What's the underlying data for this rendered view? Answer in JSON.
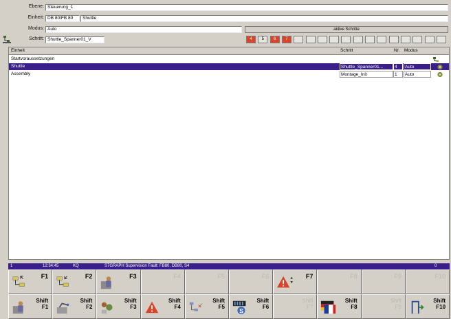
{
  "header": {
    "ebene_label": "Ebene:",
    "ebene_value": "Steuerung_1",
    "einheit_label": "Einheit:",
    "einheit_code": "DB 80/FB 80",
    "einheit_value": "Shuttle",
    "modus_label": "Modus:",
    "modus_value": "Auto",
    "schritt_label": "Schritt:",
    "schritt_value": "Shuttle_Spanner01_V",
    "active_steps_label": "aktive Schritte",
    "step_cells": [
      "4",
      "5",
      "6",
      "7",
      "",
      "",
      "",
      "",
      "",
      "",
      "",
      "",
      "",
      "",
      "",
      "",
      ""
    ]
  },
  "table": {
    "columns": {
      "einheit": "Einheit",
      "schritt": "Schritt",
      "nr": "Nr.",
      "modus": "Modus"
    },
    "rows": [
      {
        "einheit": "Startvoraussetzungen",
        "schritt": "",
        "nr": "",
        "modus": "",
        "icon": "hierarchy-icon"
      },
      {
        "einheit": "Shuttle",
        "schritt": "Shuttle_Spanner01...",
        "nr": "4",
        "modus": "Auto",
        "icon": "gear-icon"
      },
      {
        "einheit": "Assembly",
        "schritt": "Montage_Init",
        "nr": "1",
        "modus": "Auto",
        "icon": "gear-icon"
      }
    ]
  },
  "status_bar": {
    "index": "1",
    "time": "12:34:45",
    "ack": "KQ",
    "message": "S7GRAPH Supervision Fault: FB80, DB80, S4",
    "count": "0"
  },
  "fkeys_row1": [
    {
      "label": "F1",
      "icon": "unit-up-icon",
      "enabled": true
    },
    {
      "label": "F2",
      "icon": "unit-back-icon",
      "enabled": true
    },
    {
      "label": "F3",
      "icon": "operator-icon",
      "enabled": true
    },
    {
      "label": "F4",
      "icon": "",
      "enabled": false
    },
    {
      "label": "F5",
      "icon": "",
      "enabled": false
    },
    {
      "label": "F6",
      "icon": "",
      "enabled": false
    },
    {
      "label": "F7",
      "icon": "alarm-scroll-icon",
      "enabled": true
    },
    {
      "label": "F8",
      "icon": "",
      "enabled": false
    },
    {
      "label": "F9",
      "icon": "",
      "enabled": false
    },
    {
      "label": "F10",
      "icon": "",
      "enabled": false
    }
  ],
  "fkeys_row2": [
    {
      "label": "Shift\nF1",
      "icon": "operator-icon",
      "enabled": true
    },
    {
      "label": "Shift\nF2",
      "icon": "robot-icon",
      "enabled": true
    },
    {
      "label": "Shift\nF3",
      "icon": "tools-icon",
      "enabled": true
    },
    {
      "label": "Shift\nF4",
      "icon": "warning-icon",
      "enabled": true
    },
    {
      "label": "Shift\nF5",
      "icon": "network-icon",
      "enabled": true
    },
    {
      "label": "Shift\nF6",
      "icon": "s-module-icon",
      "enabled": true
    },
    {
      "label": "Shift\nF7",
      "icon": "",
      "enabled": false
    },
    {
      "label": "Shift\nF8",
      "icon": "language-flags-icon",
      "enabled": true
    },
    {
      "label": "Shift\nF9",
      "icon": "",
      "enabled": false
    },
    {
      "label": "Shift\nF10",
      "icon": "exit-door-icon",
      "enabled": true
    }
  ],
  "colors": {
    "selection": "#3a1f8a",
    "panel": "#d4d0c8",
    "alarm": "#d9442b"
  }
}
